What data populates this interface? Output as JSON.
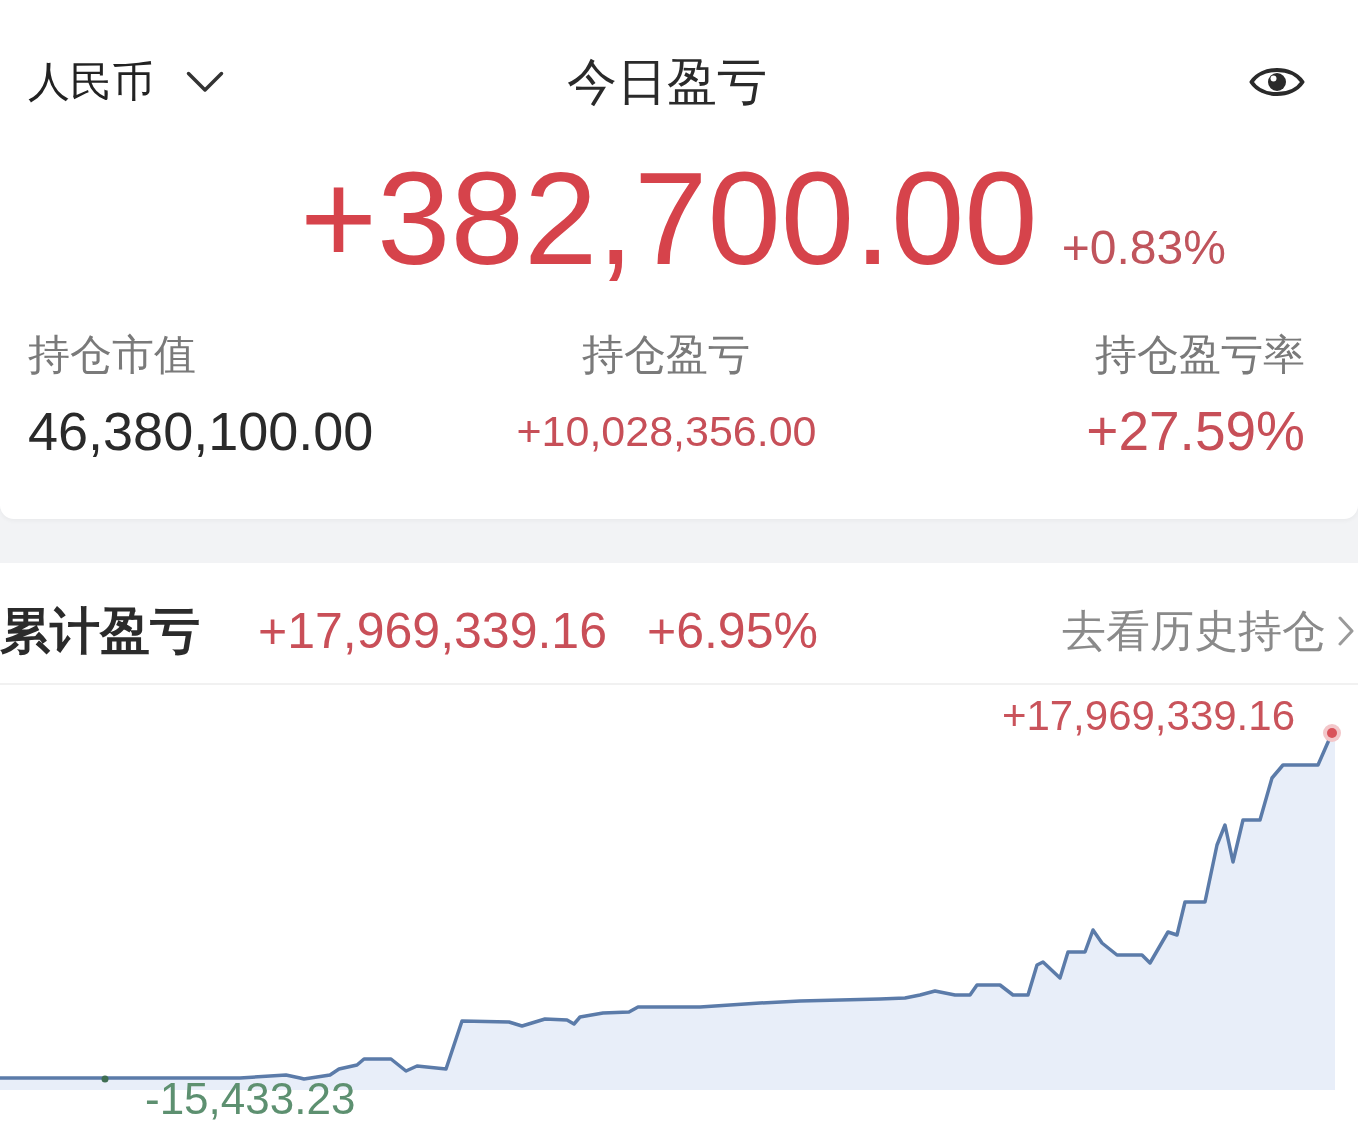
{
  "header": {
    "currency": {
      "value": "人民币"
    },
    "title": "今日盈亏",
    "privacy_toggle": {
      "visible": true
    }
  },
  "today": {
    "amount": "+382,700.00",
    "percent": "+0.83%"
  },
  "holdings": [
    {
      "label": "持仓市值",
      "value": "46,380,100.00",
      "kind": "neutral"
    },
    {
      "label": "持仓盈亏",
      "value": "+10,028,356.00",
      "kind": "gain"
    },
    {
      "label": "持仓盈亏率",
      "value": "+27.59%",
      "kind": "gain"
    }
  ],
  "cumulative": {
    "title": "累计盈亏",
    "amount": "+17,969,339.16",
    "percent": "+6.95%",
    "link": {
      "label": "去看历史持仓"
    }
  },
  "chart": {
    "labels": [
      {
        "kind": "high",
        "text": "+17,969,339.16"
      },
      {
        "kind": "low",
        "text": "-15,433.23"
      }
    ]
  }
}
